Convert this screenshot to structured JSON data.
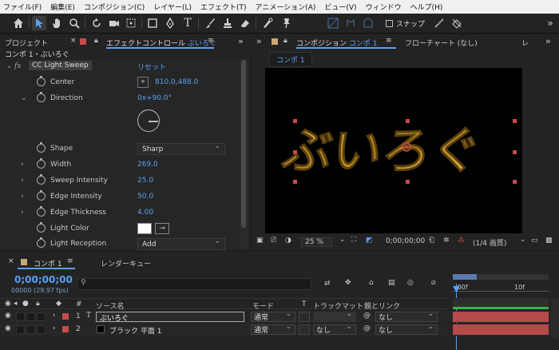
{
  "menu": [
    "ファイル(F)",
    "編集(E)",
    "コンポジション(C)",
    "レイヤー(L)",
    "エフェクト(T)",
    "アニメーション(A)",
    "ビュー(V)",
    "ウィンドウ",
    "ヘルプ(H)"
  ],
  "toolbar": {
    "snap_label": "スナップ"
  },
  "left_panel": {
    "tab_project": "プロジェクト",
    "tab_effect": "エフェクトコントロール",
    "tab_effect_target": "ぶいろぐ",
    "header": "コンポ 1・ぶいろぐ",
    "effect_name": "CC Light Sweep",
    "reset": "リセット",
    "params": [
      {
        "label": "Center",
        "value": "810.0,488.0"
      },
      {
        "label": "Direction",
        "value": "0x+90.0°"
      },
      {
        "label": "Shape",
        "value": "Sharp"
      },
      {
        "label": "Width",
        "value": "269.0"
      },
      {
        "label": "Sweep Intensity",
        "value": "25.0"
      },
      {
        "label": "Edge Intensity",
        "value": "50.0"
      },
      {
        "label": "Edge Thickness",
        "value": "4.00"
      },
      {
        "label": "Light Color",
        "value": ""
      },
      {
        "label": "Light Reception",
        "value": "Add"
      }
    ]
  },
  "comp_panel": {
    "tab_label": "コンポジション",
    "tab_comp_name": "コンポ 1",
    "tab_flowchart": "フローチャート (なし)",
    "tab_extra": "レ",
    "subtab": "コンポ 1",
    "comp_text": "ぶいろぐ",
    "zoom": "25 %",
    "timecode": "0;00;00;00",
    "resolution": "(1/4 画質)"
  },
  "timeline": {
    "tab_comp": "コンポ 1",
    "tab_render": "レンダーキュー",
    "timecode": "0;00;00;00",
    "frames": "00000 (29.97 fps)",
    "search_placeholder": "",
    "col_number": "#",
    "col_source": "ソース名",
    "col_mode": "モード",
    "col_t": "T",
    "col_trackmatte": "トラックマット",
    "col_parent": "親とリンク",
    "ruler_start": ":00f",
    "ruler_mid": "10f",
    "layers": [
      {
        "num": "1",
        "type": "T",
        "name": "ぶいろぐ",
        "mode": "通常",
        "matte": "",
        "parent": "なし",
        "color": "#c94a4a"
      },
      {
        "num": "2",
        "type": "",
        "name": "ブラック 平面 1",
        "mode": "通常",
        "matte": "なし",
        "parent": "なし",
        "color": "#c94a4a"
      }
    ]
  }
}
